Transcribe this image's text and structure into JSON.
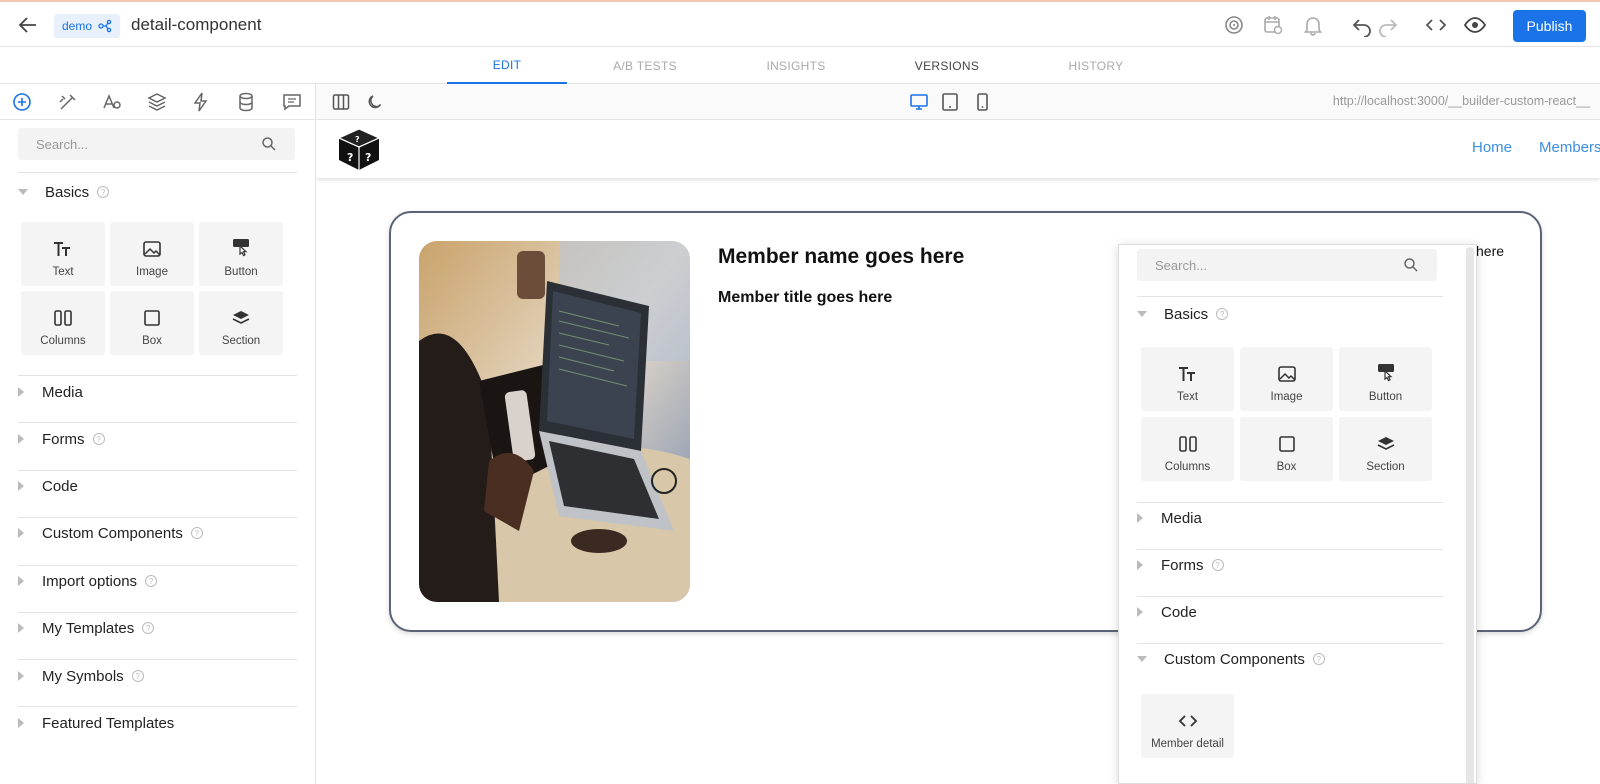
{
  "topbar": {
    "chip_label": "demo",
    "doc_title": "detail-component",
    "publish_label": "Publish"
  },
  "tabs": [
    "EDIT",
    "A/B TESTS",
    "INSIGHTS",
    "VERSIONS",
    "HISTORY"
  ],
  "left_panel": {
    "search_placeholder": "Search...",
    "basics_label": "Basics",
    "blocks": [
      "Text",
      "Image",
      "Button",
      "Columns",
      "Box",
      "Section"
    ],
    "sections": [
      "Media",
      "Forms",
      "Code",
      "Custom Components",
      "Import options",
      "My Templates",
      "My Symbols",
      "Featured Templates"
    ]
  },
  "canvas_bar": {
    "url": "http://localhost:3000/__builder-custom-react__"
  },
  "site": {
    "nav": [
      "Home",
      "Members"
    ],
    "member_name": "Member name goes here",
    "member_title": "Member title goes here",
    "trailing_text": "here"
  },
  "popup": {
    "search_placeholder": "Search...",
    "basics_label": "Basics",
    "blocks": [
      "Text",
      "Image",
      "Button",
      "Columns",
      "Box",
      "Section"
    ],
    "sections": [
      "Media",
      "Forms",
      "Code",
      "Custom Components"
    ],
    "custom_block": "Member detail"
  },
  "colors": {
    "accent": "#1a73e8",
    "nav_link": "#3b8fe0",
    "card_border": "#5a6478"
  }
}
